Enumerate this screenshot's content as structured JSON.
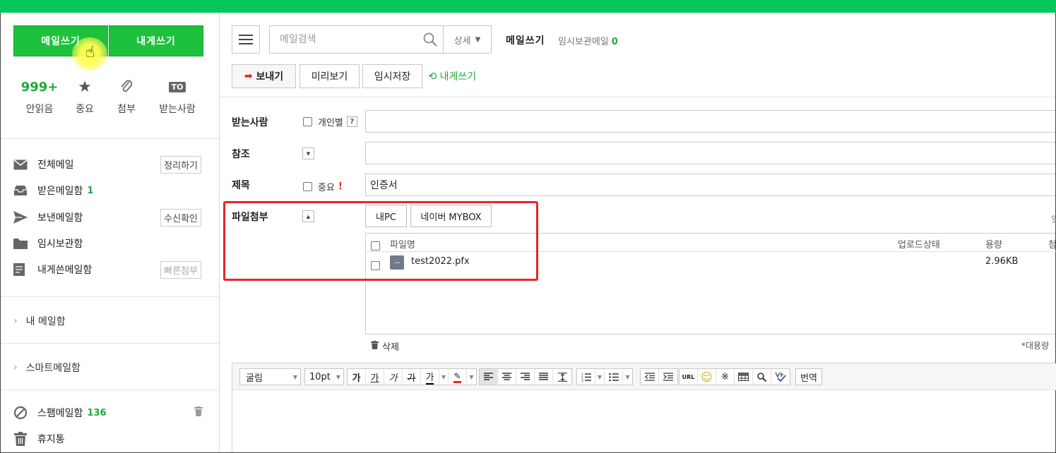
{
  "sidebar": {
    "write_button": "메일쓰기",
    "self_write_button": "내게쓰기",
    "quick": [
      {
        "top": "999+",
        "label": "안읽음",
        "icon": "unread-count"
      },
      {
        "top": "",
        "label": "중요",
        "icon": "star-icon"
      },
      {
        "top": "",
        "label": "첨부",
        "icon": "paperclip-icon"
      },
      {
        "top": "TO",
        "label": "받는사람",
        "icon": "to-badge-icon"
      }
    ],
    "items": [
      {
        "label": "전체메일",
        "count": "",
        "button": "정리하기",
        "icon": "envelope-icon"
      },
      {
        "label": "받은메일함",
        "count": "1",
        "button": "",
        "icon": "inbox-tray-icon"
      },
      {
        "label": "보낸메일함",
        "count": "",
        "button": "수신확인",
        "icon": "send-plane-icon"
      },
      {
        "label": "임시보관함",
        "count": "",
        "button": "",
        "icon": "folder-icon"
      },
      {
        "label": "내게쓴메일함",
        "count": "",
        "button": "빠른첨부",
        "icon": "note-icon"
      }
    ],
    "folders": [
      {
        "label": "내 메일함"
      },
      {
        "label": "스마트메일함"
      }
    ],
    "spam": {
      "label": "스팸메일함",
      "count": "136"
    },
    "trash": {
      "label": "휴지통"
    }
  },
  "header": {
    "search_placeholder": "메일검색",
    "detail": "상세",
    "compose_title": "메일쓰기",
    "drafts_label": "임시보관메일",
    "drafts_count": "0"
  },
  "toolbar": {
    "send": "보내기",
    "preview": "미리보기",
    "save_draft": "임시저장",
    "self_write": "내게쓰기"
  },
  "form": {
    "to_label": "받는사람",
    "individual": "개인별",
    "help": "?",
    "cc_label": "참조",
    "subject_label": "제목",
    "important": "중요",
    "exclamation": "!",
    "subject_value": "인증서",
    "attach_label": "파일첨부",
    "my_pc": "내PC",
    "mybox": "네이버 MYBOX",
    "right_cut": "일",
    "columns": {
      "name": "파일명",
      "status": "업로드상태",
      "size": "용량",
      "extra": "첨"
    },
    "files": [
      {
        "name": "test2022.pfx",
        "status": "",
        "size": "2.96KB"
      }
    ],
    "delete": "삭제",
    "bulk_note": "*대용량"
  },
  "editor": {
    "font": "굴림",
    "size": "10pt",
    "style_buttons": [
      "가",
      "가",
      "가",
      "가",
      "가"
    ],
    "url": "URL",
    "special_char": "※",
    "translate": "번역"
  },
  "colors": {
    "brand_green": "#1ec13e",
    "count_green": "#1eaa39",
    "highlight_red": "#e8242d"
  }
}
